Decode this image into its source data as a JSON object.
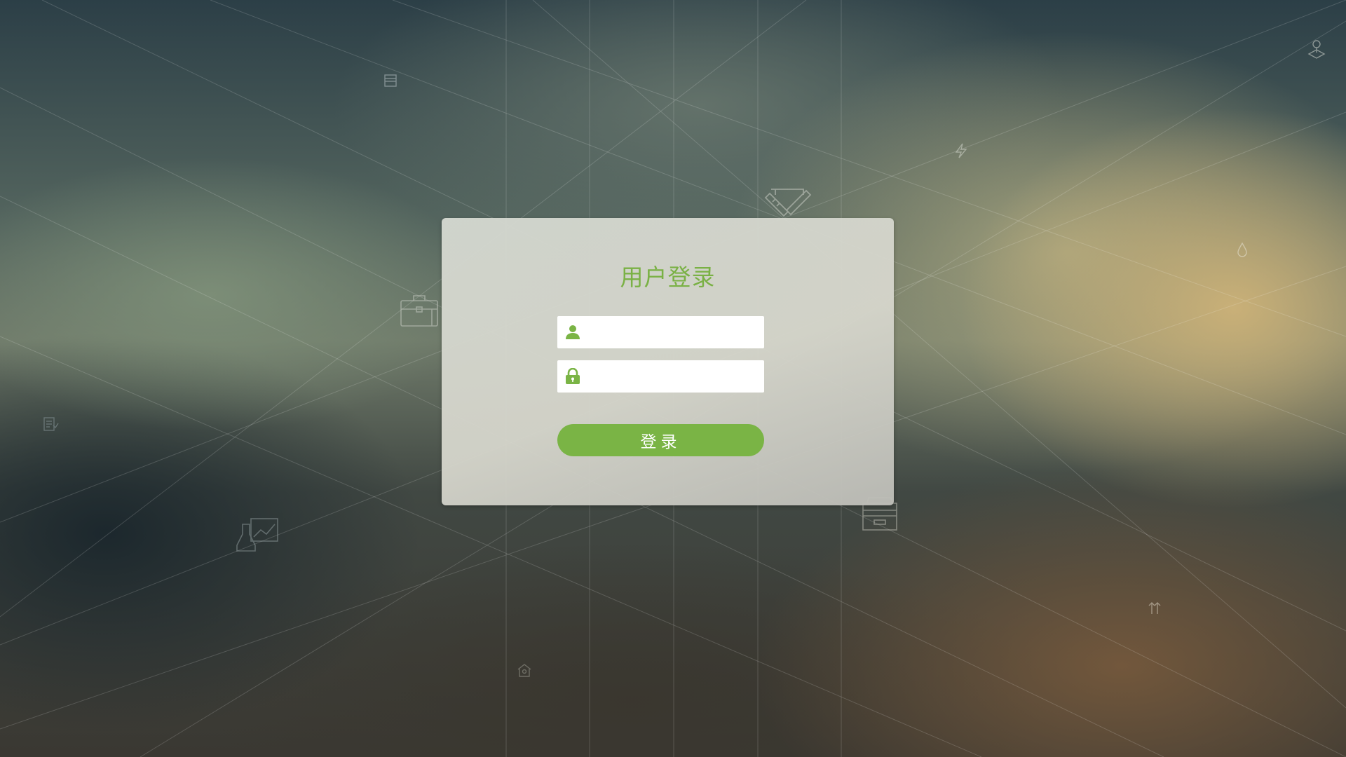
{
  "login": {
    "title": "用户登录",
    "username": {
      "icon": "user-icon",
      "value": "",
      "placeholder": ""
    },
    "password": {
      "icon": "lock-icon",
      "value": "",
      "placeholder": ""
    },
    "button_label": "登录"
  },
  "colors": {
    "accent": "#7ab445",
    "title": "#7ab145",
    "field_background": "#ffffff"
  },
  "decorative_icons": [
    "document-icon",
    "briefcase-icon",
    "ruler-pencil-icon",
    "lightning-icon",
    "map-pin-icon",
    "water-drop-icon",
    "checklist-icon",
    "flask-chart-icon",
    "archive-box-icon",
    "house-icon",
    "sort-arrows-icon"
  ]
}
